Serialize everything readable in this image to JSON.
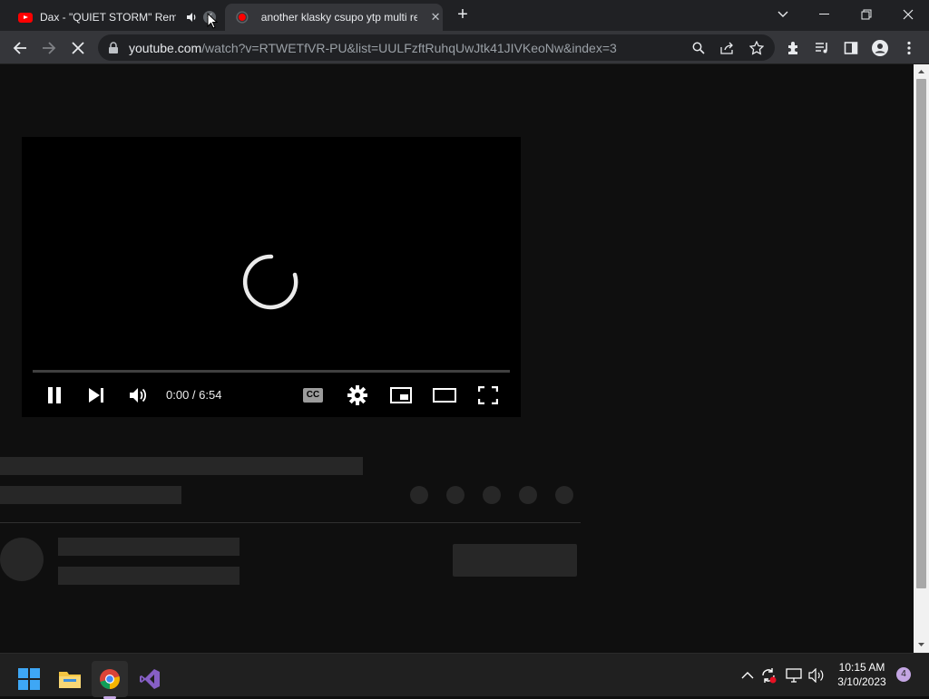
{
  "tabs": [
    {
      "title": "Dax - \"QUIET STORM\" Remix",
      "audio_icon": "speaker-icon",
      "active": false
    },
    {
      "title": "another klasky csupo ytp multi re",
      "active": true
    }
  ],
  "toolbar": {
    "url_host": "youtube.com",
    "url_path": "/watch?v=RTWETfVR-PU&list=UULFzftRuhqUwJtk41JIVKeoNw&index=3"
  },
  "player": {
    "time": "0:00 / 6:54",
    "cc_label": "CC"
  },
  "taskbar": {
    "time": "10:15 AM",
    "date": "3/10/2023",
    "notification_count": "4"
  },
  "colors": {
    "youtube_red": "#ff0000",
    "page_bg": "#0f0f0f",
    "skeleton": "#272727"
  }
}
